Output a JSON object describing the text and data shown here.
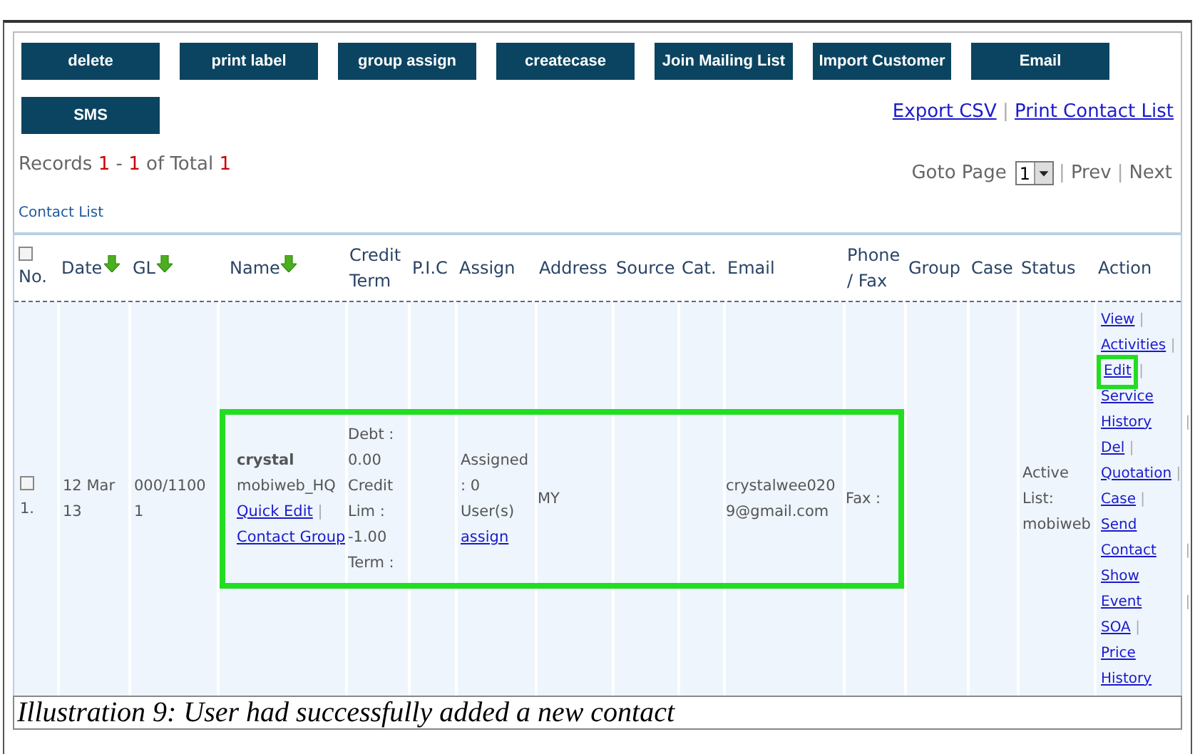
{
  "toolbar": {
    "buttons": [
      "delete",
      "print label",
      "group assign",
      "createcase",
      "Join Mailing List",
      "Import Customer",
      "Email",
      "SMS"
    ],
    "links": [
      "Export CSV",
      "Print Contact List"
    ],
    "separator": "|"
  },
  "records": {
    "label": "Records",
    "from": "1",
    "dash": "-",
    "to": "1",
    "of_total": "of Total",
    "total": "1"
  },
  "pager": {
    "label": "Goto Page",
    "page": "1",
    "separator": "|",
    "prev": "Prev",
    "next": "Next"
  },
  "list_title": "Contact List",
  "table": {
    "header_checkbox": {
      "checked": false
    },
    "columns": [
      {
        "label": "No.",
        "sortable": false
      },
      {
        "label": "Date",
        "sortable": true
      },
      {
        "label": "GL",
        "sortable": true
      },
      {
        "label": "Name",
        "sortable": true
      },
      {
        "label": "Credit Term",
        "sortable": false
      },
      {
        "label": "P.I.C",
        "sortable": false
      },
      {
        "label": "Assign",
        "sortable": false
      },
      {
        "label": "Address",
        "sortable": false
      },
      {
        "label": "Source",
        "sortable": false
      },
      {
        "label": "Cat.",
        "sortable": false
      },
      {
        "label": "Email",
        "sortable": false
      },
      {
        "label": "Phone / Fax",
        "sortable": false
      },
      {
        "label": "Group",
        "sortable": false
      },
      {
        "label": "Case",
        "sortable": false
      },
      {
        "label": "Status",
        "sortable": false
      },
      {
        "label": "Action",
        "sortable": false
      }
    ],
    "rows": [
      {
        "cells": [
          {
            "kind": "check",
            "text": "1.",
            "checked": false,
            "highlighted": false
          },
          {
            "kind": "text",
            "text": "12 Mar 13",
            "highlighted": false
          },
          {
            "kind": "text",
            "text": "000/11001",
            "highlighted": false
          },
          {
            "kind": "name",
            "name": "crystal",
            "company": "mobiweb_HQ",
            "links": [
              "Quick Edit",
              "Contact Group"
            ],
            "separator": "|",
            "highlighted": true
          },
          {
            "kind": "text",
            "text": "Debt : 0.00 Credit Lim : -1.00 Term :",
            "highlighted": true
          },
          {
            "kind": "empty",
            "highlighted": true
          },
          {
            "kind": "assign",
            "text": "Assigned : 0 User(s)",
            "link": "assign",
            "highlighted": true
          },
          {
            "kind": "text",
            "text": "MY",
            "highlighted": true
          },
          {
            "kind": "empty",
            "highlighted": true
          },
          {
            "kind": "empty",
            "highlighted": true
          },
          {
            "kind": "text",
            "text": "crystalwee0209@gmail.com",
            "highlighted": true
          },
          {
            "kind": "text",
            "text": "Fax :",
            "highlighted": true
          },
          {
            "kind": "empty",
            "highlighted": false
          },
          {
            "kind": "empty",
            "highlighted": false
          },
          {
            "kind": "text",
            "text": "Active List: mobiweb",
            "highlighted": false
          },
          {
            "kind": "actions",
            "separator": "|",
            "items": [
              {
                "text": "View",
                "highlighted": false
              },
              {
                "text": "Activities",
                "highlighted": false
              },
              {
                "text": "Edit",
                "highlighted": true
              },
              {
                "text": "Service History",
                "highlighted": false
              },
              {
                "text": "Del",
                "highlighted": false
              },
              {
                "text": "Quotation",
                "highlighted": false
              },
              {
                "text": "Case",
                "highlighted": false
              },
              {
                "text": "Send Contact",
                "highlighted": false
              },
              {
                "text": "Show Event",
                "highlighted": false
              },
              {
                "text": "SOA",
                "highlighted": false
              },
              {
                "text": "Price History",
                "highlighted": false
              }
            ],
            "highlighted": false
          }
        ]
      }
    ]
  },
  "caption": "Illustration 9: User had successfully added a new contact"
}
